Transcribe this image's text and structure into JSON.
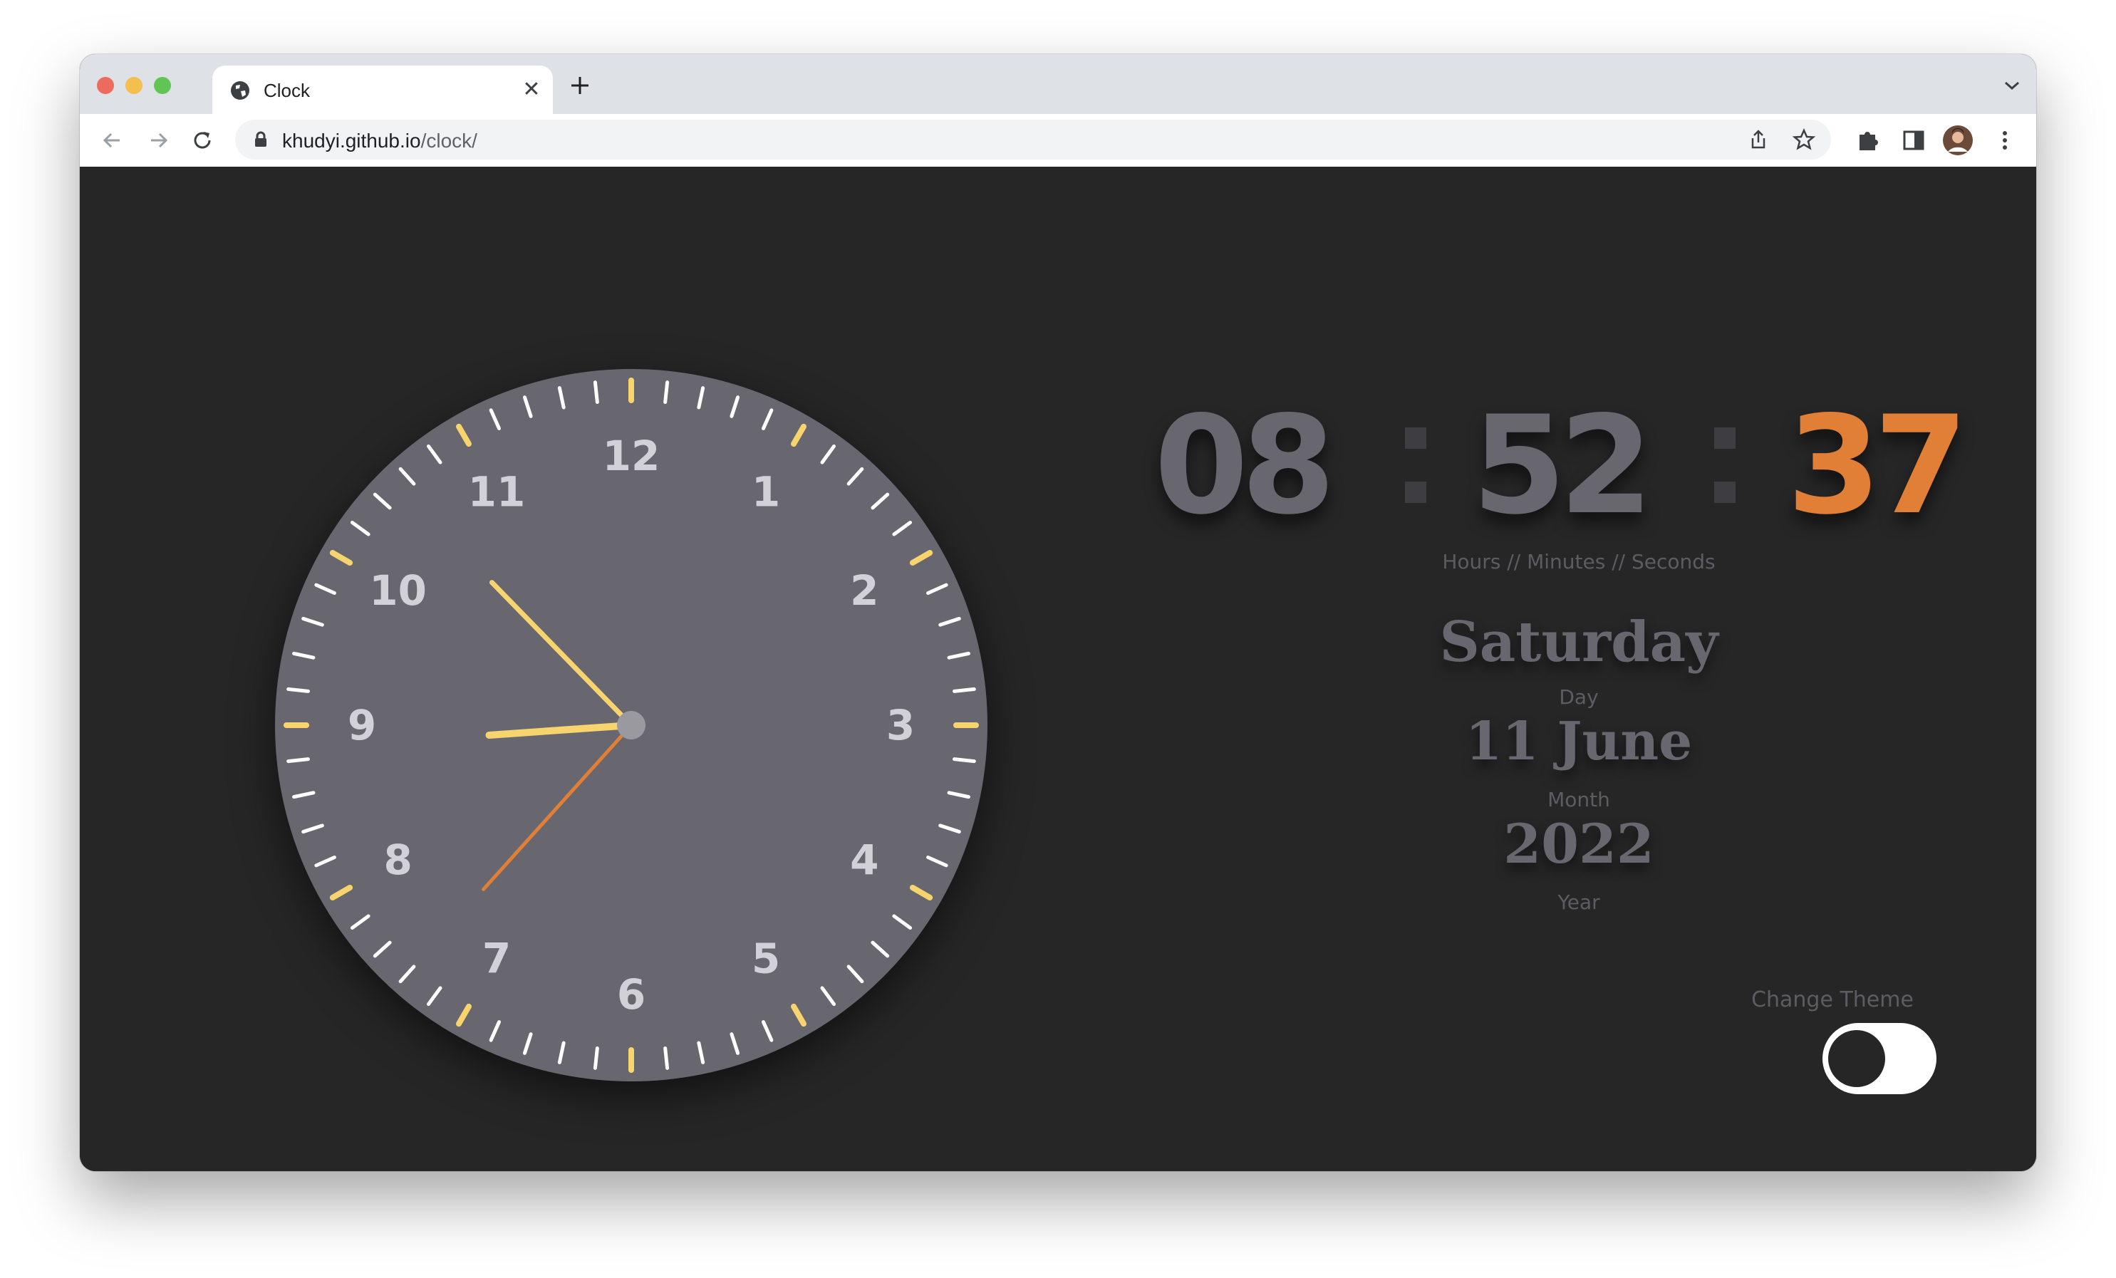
{
  "browser": {
    "tab_title": "Clock",
    "url_host": "khudyi.github.io",
    "url_path": "/clock/",
    "icons": [
      "back-icon",
      "forward-icon",
      "reload-icon",
      "lock-icon",
      "share-icon",
      "star-icon",
      "extensions-icon",
      "sidepanel-icon",
      "avatar",
      "menu-icon",
      "new-tab-icon",
      "tab-list-icon",
      "globe-icon",
      "close-icon"
    ]
  },
  "clock": {
    "numerals": [
      "12",
      "1",
      "2",
      "3",
      "4",
      "5",
      "6",
      "7",
      "8",
      "9",
      "10",
      "11"
    ],
    "time": {
      "hours": 8,
      "minutes": 52,
      "seconds": 37
    }
  },
  "digital": {
    "hours": "08",
    "minutes": "52",
    "seconds": "37",
    "caption": "Hours // Minutes // Seconds"
  },
  "date": {
    "day": "Saturday",
    "day_label": "Day",
    "month": "11 June",
    "month_label": "Month",
    "year": "2022",
    "year_label": "Year"
  },
  "theme": {
    "label": "Change Theme",
    "dark_mode": true
  },
  "colors": {
    "background": "#262626",
    "face": "#686770",
    "accent": "#f7d46e",
    "seconds": "#e07f35",
    "digits": "#686770"
  }
}
